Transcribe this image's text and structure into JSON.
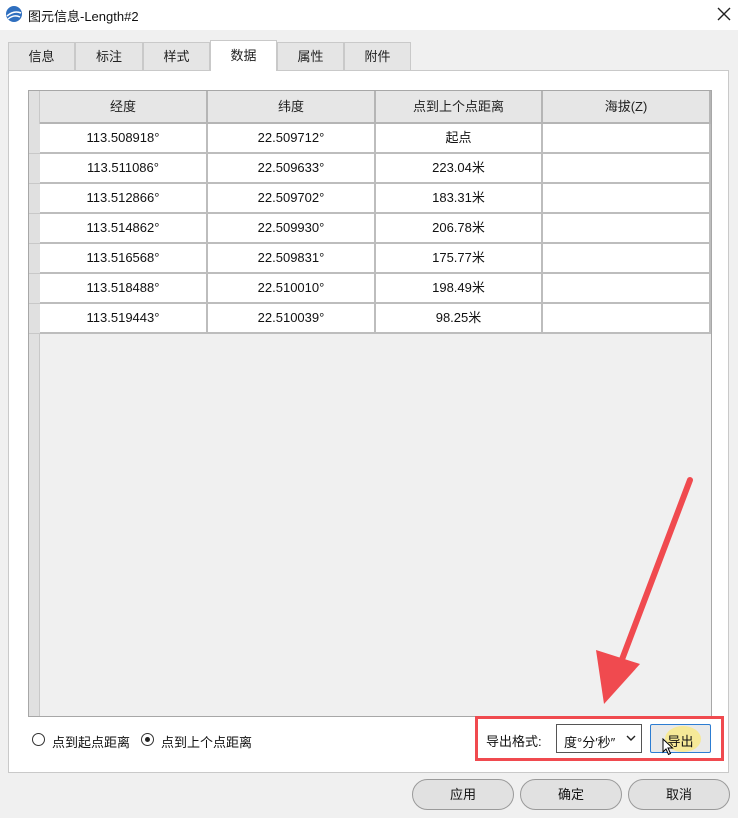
{
  "window": {
    "title": "图元信息-Length#2"
  },
  "tabs": [
    {
      "label": "信息"
    },
    {
      "label": "标注"
    },
    {
      "label": "样式"
    },
    {
      "label": "数据",
      "active": true
    },
    {
      "label": "属性"
    },
    {
      "label": "附件"
    }
  ],
  "table": {
    "columns": [
      "经度",
      "纬度",
      "点到上个点距离",
      "海拔(Z)"
    ],
    "rows": [
      [
        "113.508918°",
        "22.509712°",
        "起点",
        ""
      ],
      [
        "113.511086°",
        "22.509633°",
        "223.04米",
        ""
      ],
      [
        "113.512866°",
        "22.509702°",
        "183.31米",
        ""
      ],
      [
        "113.514862°",
        "22.509930°",
        "206.78米",
        ""
      ],
      [
        "113.516568°",
        "22.509831°",
        "175.77米",
        ""
      ],
      [
        "113.518488°",
        "22.510010°",
        "198.49米",
        ""
      ],
      [
        "113.519443°",
        "22.510039°",
        "98.25米",
        ""
      ]
    ]
  },
  "distance_mode": {
    "options": [
      {
        "label": "点到起点距离",
        "checked": false
      },
      {
        "label": "点到上个点距离",
        "checked": true
      }
    ]
  },
  "export": {
    "label": "导出格式:",
    "format_value": "度°分′秒″",
    "button_label": "导出"
  },
  "buttons": {
    "apply": "应用",
    "ok": "确定",
    "cancel": "取消"
  },
  "colors": {
    "annotation_red": "#f04a4f",
    "focus_blue": "#2d7dd2"
  },
  "icons": {
    "app": "globe-icon",
    "close": "close-icon",
    "select": "chevron-down-icon",
    "pointer": "mouse-cursor-icon"
  }
}
